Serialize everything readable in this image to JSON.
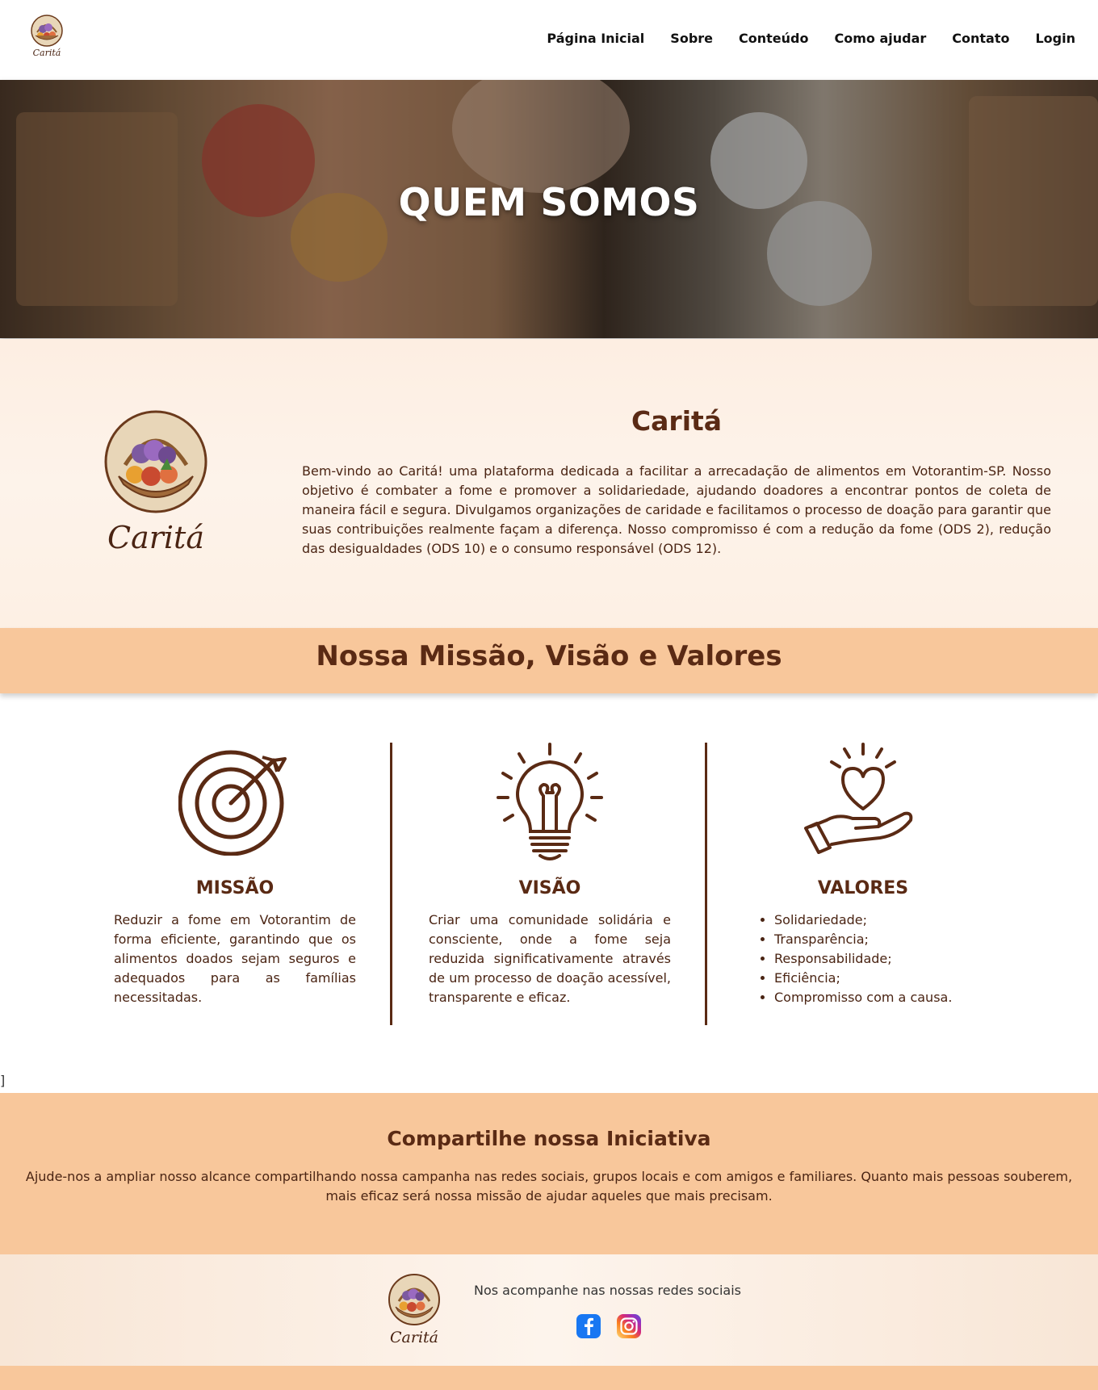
{
  "brand": {
    "name": "Caritá"
  },
  "nav": {
    "items": [
      "Página Inicial",
      "Sobre",
      "Conteúdo",
      "Como ajudar",
      "Contato",
      "Login"
    ]
  },
  "hero": {
    "title": "QUEM SOMOS"
  },
  "about": {
    "title": "Caritá",
    "text": "Bem-vindo ao Caritá! uma plataforma dedicada a facilitar a arrecadação de alimentos em Votorantim-SP. Nosso objetivo é combater a fome e promover a solidariedade, ajudando doadores a encontrar pontos de coleta de maneira fácil e segura. Divulgamos organizações de caridade e facilitamos o processo de doação para garantir que suas contribuições realmente façam a diferença. Nosso compromisso é com a redução da fome (ODS 2), redução das desigualdades (ODS 10) e o consumo responsável (ODS 12)."
  },
  "mvv": {
    "heading": "Nossa Missão, Visão e Valores",
    "missao": {
      "title": "MISSÃO",
      "icon": "target-icon",
      "text": "Reduzir a fome em Votorantim de forma eficiente, garantindo que os alimentos doados sejam seguros e adequados para as famílias necessitadas."
    },
    "visao": {
      "title": "VISÃO",
      "icon": "lightbulb-icon",
      "text": "Criar uma comunidade solidária e consciente, onde a fome seja reduzida significativamente através de um processo de doação acessível, transparente e eficaz."
    },
    "valores": {
      "title": "VALORES",
      "icon": "heart-hand-icon",
      "items": [
        "Solidariedade;",
        "Transparência;",
        "Responsabilidade;",
        "Eficiência;",
        "Compromisso com a causa."
      ]
    }
  },
  "stray_char": "]",
  "share": {
    "title": "Compartilhe nossa Iniciativa",
    "text": "Ajude-nos a ampliar nosso alcance compartilhando nossa campanha nas redes sociais, grupos locais e com amigos e familiares. Quanto mais pessoas souberem, mais eficaz será nossa missão de ajudar aqueles que mais precisam."
  },
  "footer": {
    "text": "Nos acompanhe nas nossas redes sociais",
    "socials": [
      "facebook-icon",
      "instagram-icon"
    ]
  },
  "colors": {
    "brown": "#5a2a14",
    "peach": "#f8c79b",
    "cream": "#fdf3ea"
  }
}
